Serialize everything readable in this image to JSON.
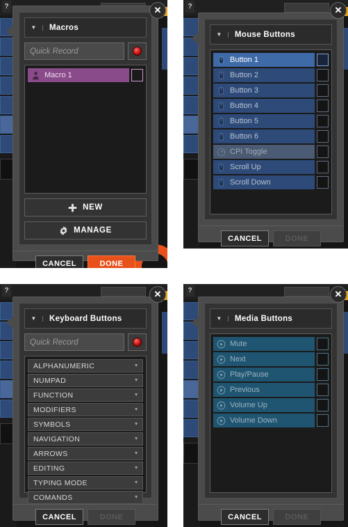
{
  "common": {
    "quick_record_placeholder": "Quick Record",
    "cancel_label": "CANCEL",
    "done_label": "DONE",
    "close_label": "✕",
    "help_label": "?",
    "caret_glyph": "▼",
    "dropdown_arrow": "▼",
    "colors": {
      "accent_orange": "#e8511a",
      "macro_purple": "#8a4b8a",
      "mouse_blue": "#2d4a78",
      "mouse_blue_selected": "#3f6aa8",
      "media_teal": "#1f5571",
      "dialog_gray": "#4b4b4b",
      "panel_dark": "#1b1b1b"
    }
  },
  "panels": [
    {
      "id": "macros",
      "title": "Macros",
      "has_quick_record": true,
      "rows": [
        {
          "label": "Macro 1",
          "icon": "user-icon",
          "checked": false,
          "style": "macro"
        }
      ],
      "actions": [
        {
          "label": "NEW",
          "icon": "plus-icon"
        },
        {
          "label": "MANAGE",
          "icon": "gear-icon"
        }
      ],
      "footer": {
        "cancel": "CANCEL",
        "done": "DONE",
        "done_enabled": true
      }
    },
    {
      "id": "mouse-buttons",
      "title": "Mouse Buttons",
      "has_quick_record": false,
      "rows": [
        {
          "label": "Button 1",
          "icon": "mouse-icon",
          "checked": false,
          "style": "mouse selected"
        },
        {
          "label": "Button 2",
          "icon": "mouse-icon",
          "checked": false,
          "style": "mouse"
        },
        {
          "label": "Button 3",
          "icon": "mouse-icon",
          "checked": false,
          "style": "mouse"
        },
        {
          "label": "Button 4",
          "icon": "mouse-icon",
          "checked": false,
          "style": "mouse"
        },
        {
          "label": "Button 5",
          "icon": "mouse-icon",
          "checked": false,
          "style": "mouse"
        },
        {
          "label": "Button 6",
          "icon": "mouse-icon",
          "checked": false,
          "style": "mouse"
        },
        {
          "label": "CPI Toggle",
          "icon": "gauge-icon",
          "checked": false,
          "style": "mouse dim"
        },
        {
          "label": "Scroll Up",
          "icon": "mouse-icon",
          "checked": false,
          "style": "mouse"
        },
        {
          "label": "Scroll Down",
          "icon": "mouse-icon",
          "checked": false,
          "style": "mouse"
        }
      ],
      "actions": [],
      "footer": {
        "cancel": "CANCEL",
        "done": "DONE",
        "done_enabled": false
      }
    },
    {
      "id": "keyboard-buttons",
      "title": "Keyboard Buttons",
      "has_quick_record": true,
      "categories": [
        "ALPHANUMERIC",
        "NUMPAD",
        "FUNCTION",
        "MODIFIERS",
        "SYMBOLS",
        "NAVIGATION",
        "ARROWS",
        "EDITING",
        "TYPING MODE",
        "COMANDS"
      ],
      "actions": [],
      "footer": {
        "cancel": "CANCEL",
        "done": "DONE",
        "done_enabled": false
      }
    },
    {
      "id": "media-buttons",
      "title": "Media Buttons",
      "has_quick_record": false,
      "rows": [
        {
          "label": "Mute",
          "icon": "play-circle-icon",
          "checked": false,
          "style": "media"
        },
        {
          "label": "Next",
          "icon": "play-circle-icon",
          "checked": false,
          "style": "media"
        },
        {
          "label": "Play/Pause",
          "icon": "play-circle-icon",
          "checked": false,
          "style": "media"
        },
        {
          "label": "Previous",
          "icon": "play-circle-icon",
          "checked": false,
          "style": "media"
        },
        {
          "label": "Volume Up",
          "icon": "play-circle-icon",
          "checked": false,
          "style": "media"
        },
        {
          "label": "Volume Down",
          "icon": "play-circle-icon",
          "checked": false,
          "style": "media"
        }
      ],
      "actions": [],
      "footer": {
        "cancel": "CANCEL",
        "done": "DONE",
        "done_enabled": false
      }
    }
  ]
}
